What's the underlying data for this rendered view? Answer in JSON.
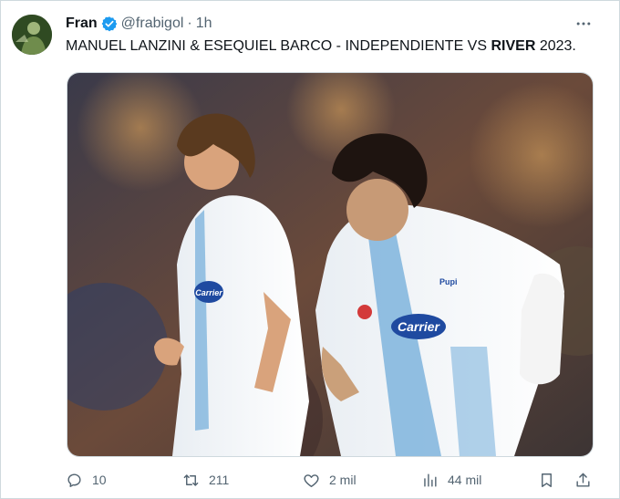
{
  "tweet": {
    "author_name": "Fran",
    "handle": "@frabigol",
    "separator": "·",
    "time": "1h",
    "text_part1": "MANUEL LANZINI & ESEQUIEL BARCO - INDEPENDIENTE VS ",
    "text_bold": "RIVER",
    "text_part2": " 2023.",
    "verified_color": "#1d9bf0"
  },
  "media": {
    "jersey_sponsor": "Carrier",
    "jersey_badge": "Pupi"
  },
  "actions": {
    "replies": "10",
    "retweets": "211",
    "likes": "2 mil",
    "views": "44 mil"
  },
  "icons": [
    "more-icon",
    "reply-icon",
    "retweet-icon",
    "like-icon",
    "views-icon",
    "bookmark-icon",
    "share-icon",
    "verified-icon"
  ]
}
